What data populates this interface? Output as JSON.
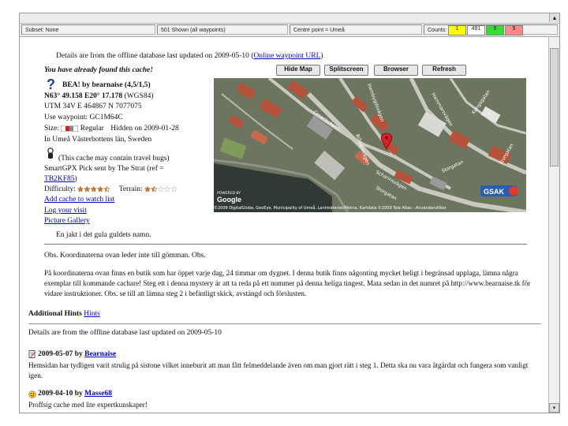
{
  "status": {
    "subset": "Subset: None",
    "shown": "501 Shown (all waypoints)",
    "centre": "Centre point = Umeå",
    "counts_label": "Counts:",
    "counts": [
      {
        "value": "1",
        "color": "#ffff00"
      },
      {
        "value": "491",
        "color": "#ffffff"
      },
      {
        "value": "9",
        "color": "#33dd33"
      },
      {
        "value": "9",
        "color": "#ff8888"
      }
    ]
  },
  "details_line": {
    "prefix": "Details are from the offline database last updated on 2009-05-10 (",
    "link": "Online waypoint URL",
    "suffix": ")"
  },
  "found_text": "You have already found this cache!",
  "buttons": {
    "hide_map": "Hide Map",
    "splitscreen": "Splitscreen",
    "browser": "Browser",
    "refresh": "Refresh"
  },
  "cache": {
    "title": "BEA! by bearnaise (4,5/1,5)",
    "coords_bold": "N63° 49.158  E20° 17.178",
    "coords_suffix": " (WGS84)",
    "utm": "UTM  34V   E 464867  N 7077075",
    "waypoint": "Use waypoint: GC1M64C",
    "size_label": "Size:",
    "size_value": "Regular",
    "hidden": "Hidden on 2009-01-28",
    "location": "In Umeå Västerbottens län, Sweden",
    "travel_bugs": "(This cache may contain travel bugs)",
    "pick_prefix": "SmartGPX Pick sent by The Strat (ref =",
    "pick_ref": "TB2KF85",
    "pick_suffix": ")",
    "difficulty_label": "Difficulty:",
    "terrain_label": "Terrain:",
    "difficulty": 4.5,
    "terrain": 1.5,
    "add_watch": "Add cache to watch list",
    "log_visit": "Log your visit",
    "gallery": "Picture Gallery",
    "short_desc": "En jakt i det gula guldets namn."
  },
  "description": {
    "p1": "Obs. Koordinaterna ovan leder inte till gömman. Obs.",
    "p2": "På koordinaterna ovan finns en butik som har öppet varje dag, 24 timmar om dygnet. I denna butik finns någonting mycket heligt i begränsad upplaga, lämna några exemplar till kommande cachare! Steg ett i denna mystery är att ta reda på ett nummer på denna heliga tingest. Mata sedan in det numret på http://www.bearnaise.tk för vidare instruktioner. Obs. se till att lämna steg 2 i befintligt skick, avstängd och förslusten."
  },
  "hints": {
    "heading": "Additional Hints",
    "link": "Hints"
  },
  "details_line2": "Details are from the offline database last updated on 2009-05-10",
  "logs": [
    {
      "date": "2009-05-07 by ",
      "author": "Bearnaise",
      "text": "Hemsidan har tydligen varit strulig på sistone vilket inneburit att man fått felmeddelande även om man gjort rätt i steg 1. Detta ska nu vara åtgärdat och fungera som vanligt igen."
    },
    {
      "date": "2009-04-10 by ",
      "author": "Masse68",
      "text": "Proffsig cache med lite expertkunskaper!"
    }
  ],
  "map": {
    "powered_by": "POWERED BY",
    "google": "Google",
    "copyright": "©2009 DigitalGlobe, GeoEye, Municipality of Umeå, Lantmäteriet/Metria, Kartdata ©2009 Tele Atlas - Användarvillkor",
    "gsak": "GSAK",
    "streets": [
      "Croackvägen",
      "Blåbärsvägen",
      "Hembygdsvägen",
      "Hammarsvägen",
      "Kungsgatan",
      "Storgatan",
      "Storgatan",
      "Scharinsvägen",
      "Storgatan"
    ]
  },
  "colors": {
    "link": "#0000cc",
    "map_water": "#2f3a35",
    "map_road": "#c9c9c0",
    "roof_red": "#b5533a"
  }
}
